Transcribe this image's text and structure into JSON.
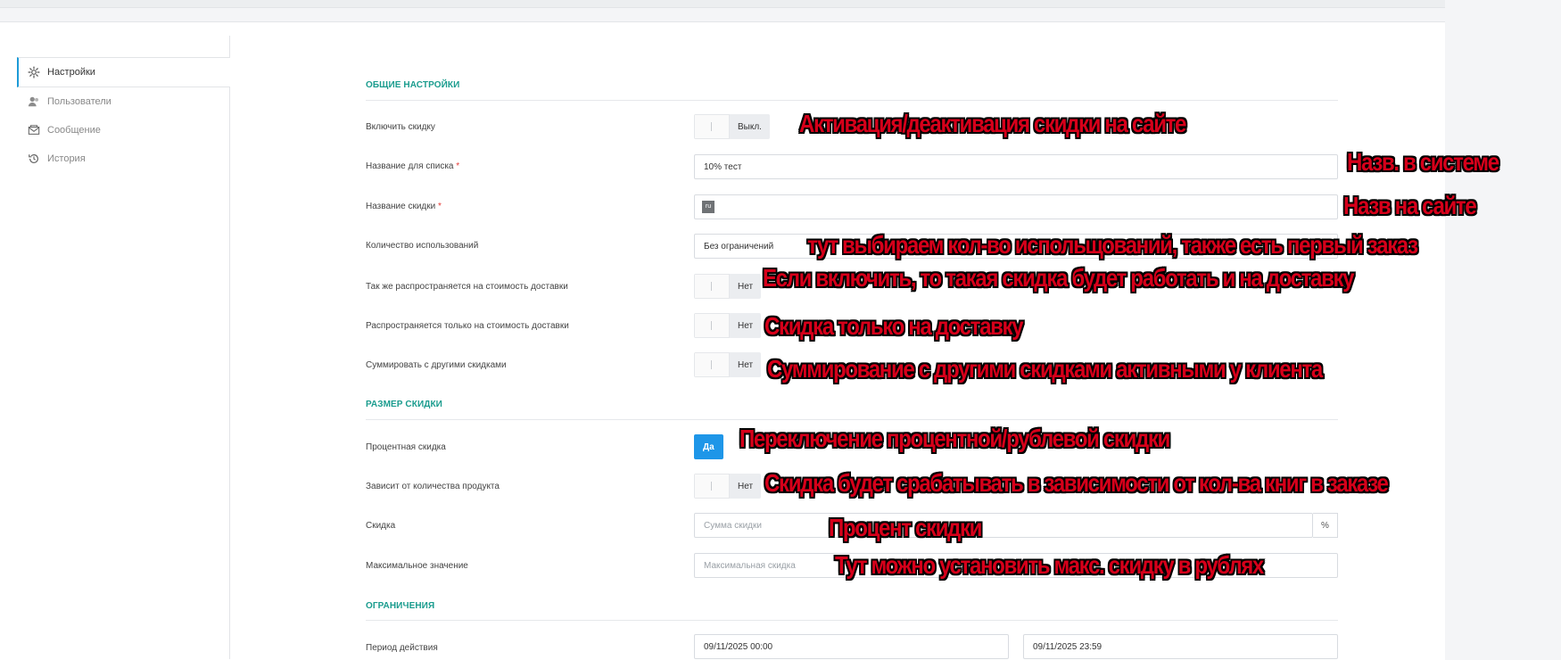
{
  "sidebar": {
    "items": [
      {
        "label": "Настройки",
        "icon": "gear-icon",
        "active": true
      },
      {
        "label": "Пользователи",
        "icon": "users-icon",
        "active": false
      },
      {
        "label": "Сообщение",
        "icon": "envelope-icon",
        "active": false
      },
      {
        "label": "История",
        "icon": "history-icon",
        "active": false
      }
    ]
  },
  "sections": {
    "general": "ОБЩИЕ НАСТРОЙКИ",
    "size": "РАЗМЕР СКИДКИ",
    "limits": "ОГРАНИЧЕНИЯ"
  },
  "fields": {
    "enable_discount": {
      "label": "Включить скидку",
      "state": "Выкл."
    },
    "list_name": {
      "label": "Название для списка",
      "required": "*",
      "value": "10% тест"
    },
    "discount_name": {
      "label": "Название скидки",
      "required": "*",
      "lang": "ru",
      "value": ""
    },
    "usage_count": {
      "label": "Количество использований",
      "value": "Без ограничений"
    },
    "applies_delivery": {
      "label": "Так же распространяется на стоимость доставки",
      "state": "Нет"
    },
    "only_delivery": {
      "label": "Распространяется только на стоимость доставки",
      "state": "Нет"
    },
    "sum_with_other": {
      "label": "Суммировать с другими скидками",
      "state": "Нет"
    },
    "percent_discount": {
      "label": "Процентная скидка",
      "state": "Да"
    },
    "depends_qty": {
      "label": "Зависит от количества продукта",
      "state": "Нет"
    },
    "discount": {
      "label": "Скидка",
      "placeholder": "Сумма скидки",
      "suffix": "%"
    },
    "max_value": {
      "label": "Максимальное значение",
      "placeholder": "Максимальная скидка"
    },
    "period": {
      "label": "Период действия",
      "from": "09/11/2025 00:00",
      "to": "09/11/2025 23:59"
    }
  },
  "annotations": {
    "a1": "Активация/деактивация скидки на сайте",
    "a2": "Назв. в системе",
    "a3": "Назв на сайте",
    "a4": "тут выбираем кол-во испольщований, также есть первый заказ",
    "a5": "Если включить, то такая скидка будет работать и на доставку",
    "a6": "Скидка только на доставку",
    "a7": "Суммирование с другими скидками активными у клиента",
    "a8": "Переключение процентной/рублевой скидки",
    "a9": "Скидка будет срабатывать в зависимости от кол-ва книг в заказе",
    "a10": "Процент скидки",
    "a11": "Тут можно установить макс. скидку в рублях"
  },
  "colors": {
    "accent": "#1e96e8",
    "section": "#1a9c8e",
    "annotation": "#d6001a"
  }
}
